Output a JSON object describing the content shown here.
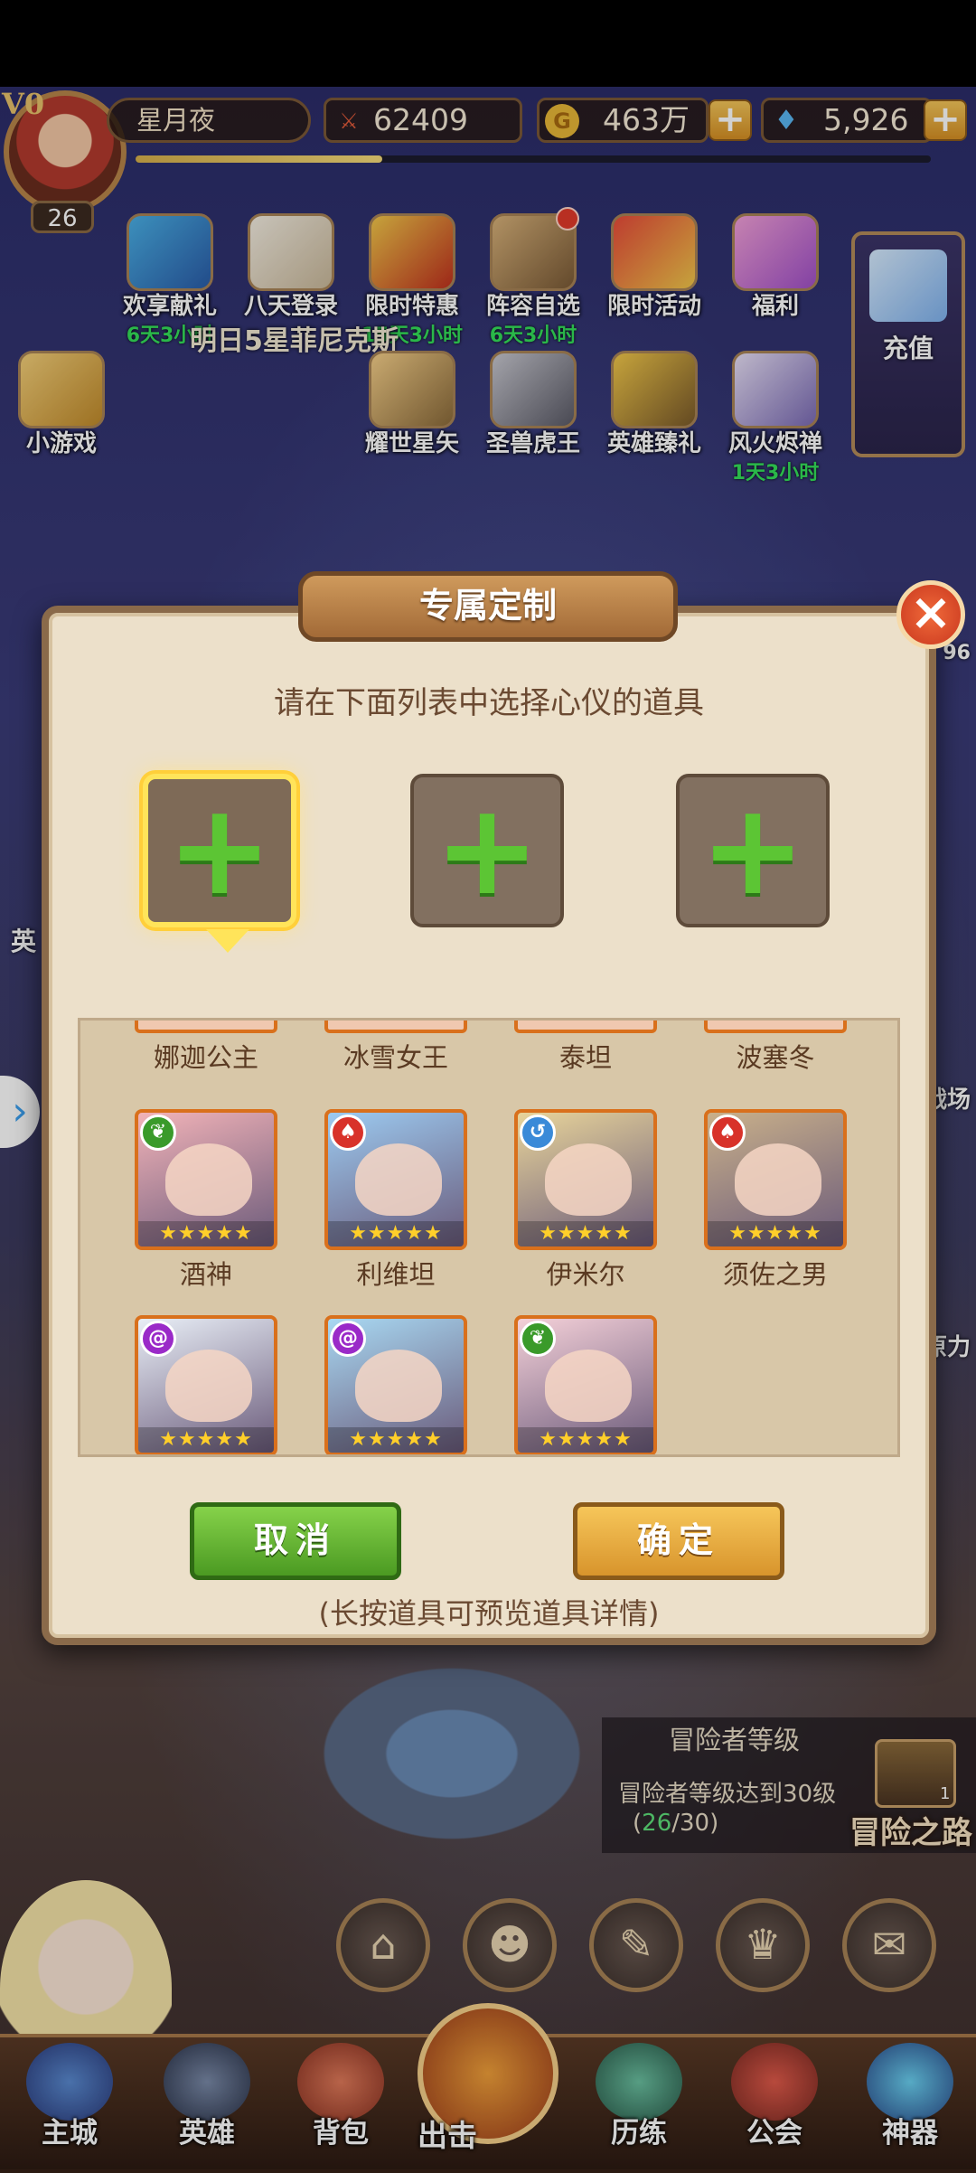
{
  "player": {
    "vip": "V0",
    "name": "星月夜",
    "level": "26",
    "xp_progress": 0.31
  },
  "resources": {
    "power": "62409",
    "gold": "463万",
    "diamonds": "5,926"
  },
  "events": [
    {
      "label": "欢享献礼",
      "timer": "6天3小时",
      "badge": false
    },
    {
      "label": "八天登录",
      "timer": "",
      "badge": false
    },
    {
      "label": "限时特惠",
      "timer": "15天3小时",
      "badge": false
    },
    {
      "label": "阵容自选",
      "timer": "6天3小时",
      "badge": true
    },
    {
      "label": "限时活动",
      "timer": "",
      "badge": false
    },
    {
      "label": "福利",
      "timer": "",
      "badge": false
    }
  ],
  "events_row2": [
    {
      "label": "小游戏",
      "timer": ""
    },
    {
      "label": "耀世星矢",
      "timer": ""
    },
    {
      "label": "圣兽虎王",
      "timer": ""
    },
    {
      "label": "英雄臻礼",
      "timer": ""
    },
    {
      "label": "风火烬禅",
      "timer": "1天3小时"
    }
  ],
  "recharge_label": "充值",
  "promo_banner": "明日5星菲尼克斯",
  "side": {
    "left_fragment": "英",
    "right_fragments": [
      "96",
      "战场",
      "原力"
    ]
  },
  "modal": {
    "title": "专属定制",
    "instruction": "请在下面列表中选择心仪的道具",
    "slots": [
      "selected",
      "empty",
      "empty"
    ],
    "top_row_names": [
      "娜迦公主",
      "冰雪女王",
      "泰坦",
      "波塞冬"
    ],
    "heroes": [
      {
        "name": "酒神",
        "element": "nature",
        "stars": "★★★★★",
        "color": "#f2b3b8"
      },
      {
        "name": "利维坦",
        "element": "fire",
        "stars": "★★★★★",
        "color": "#9ccaf0"
      },
      {
        "name": "伊米尔",
        "element": "wind",
        "stars": "★★★★★",
        "color": "#e8d49a"
      },
      {
        "name": "须佐之男",
        "element": "fire",
        "stars": "★★★★★",
        "color": "#c9b08a"
      },
      {
        "name": "",
        "element": "dark",
        "stars": "★★★★★",
        "color": "#e8eef6"
      },
      {
        "name": "",
        "element": "dark",
        "stars": "★★★★★",
        "color": "#a8d8f2"
      },
      {
        "name": "",
        "element": "nature",
        "stars": "★★★★★",
        "color": "#f4d0d8"
      }
    ],
    "cancel_label": "取消",
    "confirm_label": "确定",
    "hint": "(长按道具可预览道具详情)"
  },
  "quest": {
    "title": "冒险者等级",
    "description": "冒险者等级达到30级",
    "progress_open": "(",
    "progress_current": "26",
    "progress_rest": "/30)",
    "road_label": "冒险之路",
    "count": "1"
  },
  "nav": {
    "items": [
      "主城",
      "英雄",
      "背包",
      "出击",
      "历练",
      "公会",
      "神器"
    ]
  },
  "colors": {
    "accent_gold": "#d6b04c",
    "cancel_green": "#4b9a22",
    "confirm_orange": "#d8942c",
    "timer_green": "#34e05a"
  }
}
